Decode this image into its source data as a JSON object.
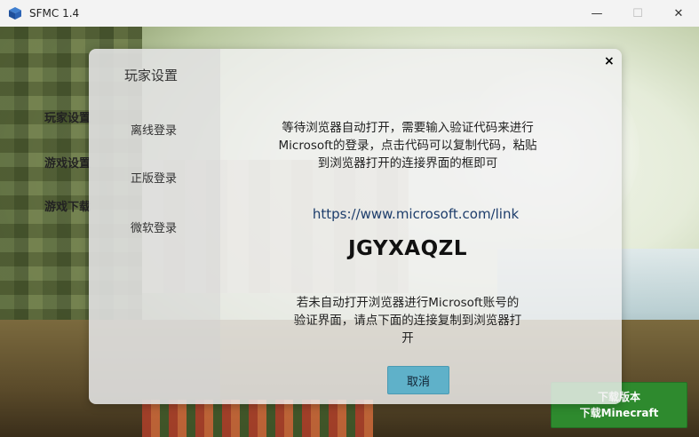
{
  "window": {
    "title": "SFMC 1.4",
    "minimize_glyph": "—",
    "maximize_glyph": "☐",
    "close_glyph": "✕"
  },
  "sidebar": {
    "items": [
      {
        "label": "玩家设置"
      },
      {
        "label": "游戏设置"
      },
      {
        "label": "游戏下载"
      }
    ]
  },
  "download_button": {
    "line1": "下载版本",
    "line2": "下载Minecraft",
    "color": "#2e8a2e"
  },
  "dialog": {
    "title": "玩家设置",
    "close_glyph": "×",
    "nav": [
      {
        "label": "离线登录"
      },
      {
        "label": "正版登录"
      },
      {
        "label": "微软登录"
      }
    ],
    "instruction_lines": [
      "等待浏览器自动打开，需要输入验证代码来进行",
      "Microsoft的登录，点击代码可以复制代码，粘贴",
      "到浏览器打开的连接界面的框即可"
    ],
    "link": "https://www.microsoft.com/link",
    "code": "JGYXAQZL",
    "fallback_lines": [
      "若未自动打开浏览器进行Microsoft账号的",
      "验证界面，请点下面的连接复制到浏览器打",
      "开"
    ],
    "cancel_label": "取消",
    "cancel_color": "#5fb1c9",
    "link_color": "#1d3d6b"
  }
}
